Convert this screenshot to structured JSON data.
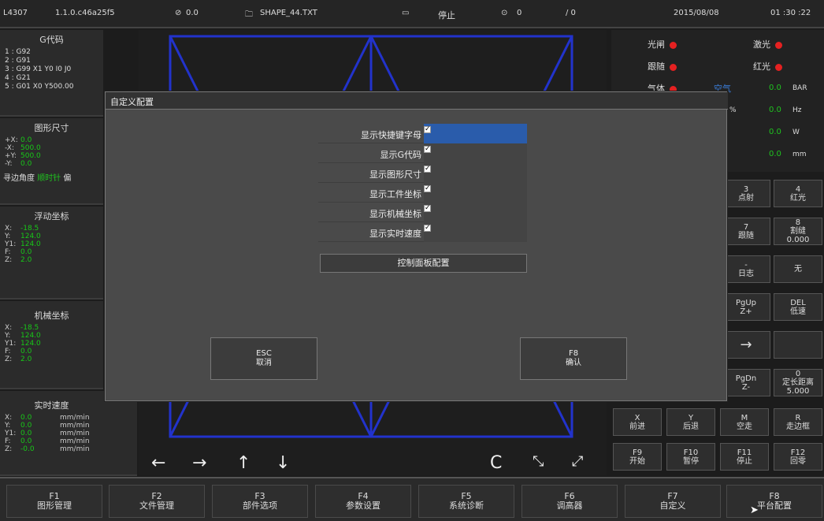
{
  "status_bar": {
    "id": "L4307",
    "version": "1.1.0.c46a25f5",
    "speed": "0.0",
    "file": "SHAPE_44.TXT",
    "state": "停止",
    "count": "0",
    "ratio": "/ 0",
    "date": "2015/08/08",
    "time": "01 :30 :22"
  },
  "gcode": {
    "title": "G代码",
    "lines": [
      "1 : G92",
      "2 : G91",
      "3 : G99 X1 Y0 I0 J0",
      "4 : G21",
      "5 : G01 X0 Y500.00"
    ]
  },
  "shape_size": {
    "title": "图形尺寸",
    "rows": [
      {
        "k": "+X:",
        "v": "0.0"
      },
      {
        "k": "-X:",
        "v": "500.0"
      },
      {
        "k": "+Y:",
        "v": "500.0"
      },
      {
        "k": "-Y:",
        "v": "0.0"
      }
    ],
    "edge_label": "寻边角度",
    "edge_value": "顺时针",
    "edge_extra": "偏"
  },
  "float_coords": {
    "title": "浮动坐标",
    "rows": [
      {
        "k": "X:",
        "v": "-18.5"
      },
      {
        "k": "Y:",
        "v": "124.0"
      },
      {
        "k": "Y1:",
        "v": "124.0"
      },
      {
        "k": "F:",
        "v": "0.0"
      },
      {
        "k": "Z:",
        "v": "2.0"
      }
    ]
  },
  "machine_coords": {
    "title": "机械坐标",
    "rows": [
      {
        "k": "X:",
        "v": "-18.5"
      },
      {
        "k": "Y:",
        "v": "124.0"
      },
      {
        "k": "Y1:",
        "v": "124.0"
      },
      {
        "k": "F:",
        "v": "0.0"
      },
      {
        "k": "Z:",
        "v": "2.0"
      }
    ]
  },
  "realtime_speed": {
    "title": "实时速度",
    "rows": [
      {
        "k": "X:",
        "v": "0.0",
        "u": "mm/min"
      },
      {
        "k": "Y:",
        "v": "0.0",
        "u": "mm/min"
      },
      {
        "k": "Y1:",
        "v": "0.0",
        "u": "mm/min"
      },
      {
        "k": "F:",
        "v": "0.0",
        "u": "mm/min"
      },
      {
        "k": "Z:",
        "v": "-0.0",
        "u": "mm/min"
      }
    ]
  },
  "indicators": {
    "shutter": "光闸",
    "laser": "激光",
    "follow": "跟随",
    "red": "红光",
    "gas": "气体",
    "air": "空气",
    "pressure": "0.0",
    "pressure_unit": "BAR",
    "pct": "%",
    "freq": "0.0",
    "freq_unit": "Hz",
    "power": "0.0",
    "power_unit": "W",
    "dist": "0.0",
    "dist_unit": "mm"
  },
  "grid_buttons": {
    "b3": "3\n点射",
    "b4": "4\n红光",
    "b7": "7\n跟随",
    "b8": "8\n割缝\n0.000",
    "bdash": "-\n日志",
    "bnone": "无",
    "bpgup": "PgUp\nZ+",
    "bdel": "DEL\n低速",
    "bright": "→",
    "bpgdn": "PgDn\nZ-",
    "b0": "0\n定长距离\n5.000",
    "bx": "X\n前进",
    "by": "Y\n后退",
    "bm": "M\n空走",
    "br": "R\n走边框",
    "bf9": "F9\n开始",
    "bf10": "F10\n暂停",
    "bf11": "F11\n停止",
    "bf12": "F12\n回零"
  },
  "canvas_controls": {
    "left": "←",
    "right": "→",
    "up": "↑",
    "down": "↓",
    "refresh": "C",
    "shrink": "⤡",
    "expand": "⤢"
  },
  "fkeys": [
    {
      "k": "F1",
      "l": "图形管理"
    },
    {
      "k": "F2",
      "l": "文件管理"
    },
    {
      "k": "F3",
      "l": "部件选项"
    },
    {
      "k": "F4",
      "l": "参数设置"
    },
    {
      "k": "F5",
      "l": "系统诊断"
    },
    {
      "k": "F6",
      "l": "调高器"
    },
    {
      "k": "F7",
      "l": "自定义"
    },
    {
      "k": "F8",
      "l": "平台配置"
    }
  ],
  "dialog": {
    "title": "自定义配置",
    "options": [
      {
        "label": "显示快捷键字母",
        "checked": true
      },
      {
        "label": "显示G代码",
        "checked": true
      },
      {
        "label": "显示图形尺寸",
        "checked": true
      },
      {
        "label": "显示工件坐标",
        "checked": true
      },
      {
        "label": "显示机械坐标",
        "checked": true
      },
      {
        "label": "显示实时速度",
        "checked": true
      }
    ],
    "panel_button": "控制面板配置",
    "cancel_key": "ESC",
    "cancel_label": "取消",
    "confirm_key": "F8",
    "confirm_label": "确认"
  },
  "colors": {
    "accent_green": "#1fc31f",
    "indicator_red": "#e52121",
    "selection_blue": "#2a5cab",
    "frame_blue": "#2233cc"
  }
}
